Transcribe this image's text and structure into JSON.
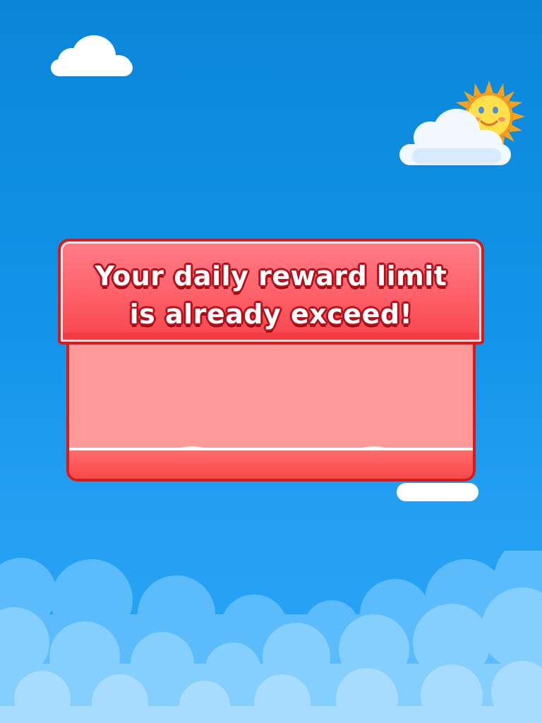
{
  "dialog": {
    "title_line1": "Your daily reward limit",
    "title_line2": "is already exceed!"
  },
  "buttons": {
    "home": {
      "icon": "home-icon"
    },
    "replay": {
      "icon": "replay-icon"
    }
  },
  "colors": {
    "sky_top": "#0a86d8",
    "sky_bottom": "#2aa4f5",
    "header_red": "#ff6069",
    "border_red": "#d91a1a",
    "body_pink": "#ff9898",
    "button_gold": "#ffcf1c",
    "sun_orange": "#f7a21b"
  }
}
